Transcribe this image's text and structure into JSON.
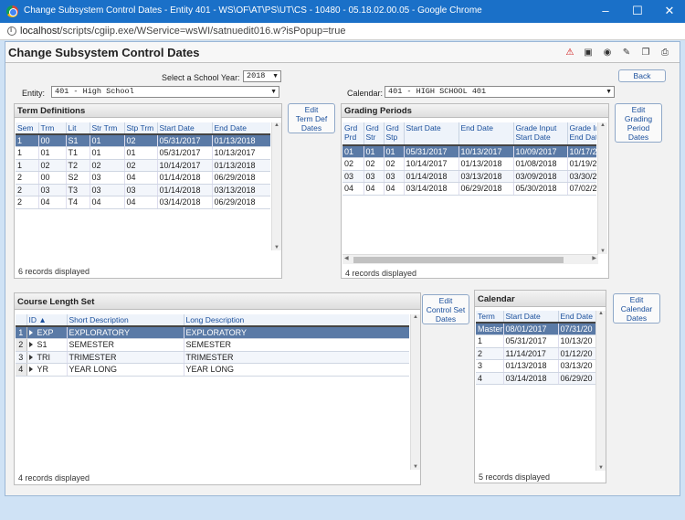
{
  "window": {
    "title": "Change Subsystem Control Dates - Entity 401 - WS\\OF\\AT\\PS\\UT\\CS - 10480 - 05.18.02.00.05 - Google Chrome",
    "url_host": "localhost",
    "url_path": "/scripts/cgiip.exe/WService=wsWI/satnuedit016.w?isPopup=true"
  },
  "page": {
    "title": "Change Subsystem Control Dates",
    "back_label": "Back",
    "school_year_label": "Select a School Year:",
    "school_year_value": "2018",
    "entity_label": "Entity:",
    "entity_value": "401 - High School",
    "calendar_label": "Calendar:",
    "calendar_value": "401 - HIGH SCHOOL 401"
  },
  "toolbar_icons": [
    "alert-icon",
    "screen-icon",
    "camera-icon",
    "notes-icon",
    "copy-icon",
    "print-icon"
  ],
  "term_definitions": {
    "title": "Term Definitions",
    "button_label": [
      "Edit",
      "Term Def",
      "Dates"
    ],
    "columns": [
      "Sem",
      "Trm",
      "Lit",
      "Str Trm",
      "Stp Trm",
      "Start Date",
      "End Date"
    ],
    "rows": [
      [
        "1",
        "00",
        "S1",
        "01",
        "02",
        "05/31/2017",
        "01/13/2018"
      ],
      [
        "1",
        "01",
        "T1",
        "01",
        "01",
        "05/31/2017",
        "10/13/2017"
      ],
      [
        "1",
        "02",
        "T2",
        "02",
        "02",
        "10/14/2017",
        "01/13/2018"
      ],
      [
        "2",
        "00",
        "S2",
        "03",
        "04",
        "01/14/2018",
        "06/29/2018"
      ],
      [
        "2",
        "03",
        "T3",
        "03",
        "03",
        "01/14/2018",
        "03/13/2018"
      ],
      [
        "2",
        "04",
        "T4",
        "04",
        "04",
        "03/14/2018",
        "06/29/2018"
      ]
    ],
    "footer": "6 records displayed"
  },
  "grading_periods": {
    "title": "Grading Periods",
    "button_label": [
      "Edit",
      "Grading",
      "Period",
      "Dates"
    ],
    "columns": [
      [
        "Grd",
        "Prd"
      ],
      [
        "Grd",
        "Str"
      ],
      [
        "Grd",
        "Stp"
      ],
      [
        "Start Date"
      ],
      [
        "End Date"
      ],
      [
        "Grade Input",
        "Start Date"
      ],
      [
        "Grade In",
        "End Date"
      ]
    ],
    "rows": [
      [
        "01",
        "01",
        "01",
        "05/31/2017",
        "10/13/2017",
        "10/09/2017",
        "10/17/2"
      ],
      [
        "02",
        "02",
        "02",
        "10/14/2017",
        "01/13/2018",
        "01/08/2018",
        "01/19/2"
      ],
      [
        "03",
        "03",
        "03",
        "01/14/2018",
        "03/13/2018",
        "03/09/2018",
        "03/30/2"
      ],
      [
        "04",
        "04",
        "04",
        "03/14/2018",
        "06/29/2018",
        "05/30/2018",
        "07/02/2"
      ]
    ],
    "footer": "4 records displayed"
  },
  "course_length_set": {
    "title": "Course Length Set",
    "button_label": [
      "Edit",
      "Control Set",
      "Dates"
    ],
    "columns": [
      "ID",
      "Short Description",
      "Long Description"
    ],
    "rows": [
      [
        "1",
        "EXP",
        "EXPLORATORY",
        "EXPLORATORY"
      ],
      [
        "2",
        "S1",
        "SEMESTER",
        "SEMESTER"
      ],
      [
        "3",
        "TRI",
        "TRIMESTER",
        "TRIMESTER"
      ],
      [
        "4",
        "YR",
        "YEAR LONG",
        "YEAR LONG"
      ]
    ],
    "footer": "4 records displayed"
  },
  "calendar": {
    "title": "Calendar",
    "button_label": [
      "Edit",
      "Calendar",
      "Dates"
    ],
    "columns": [
      "Term",
      "Start Date",
      "End Date"
    ],
    "rows": [
      [
        "Master",
        "08/01/2017",
        "07/31/20"
      ],
      [
        "1",
        "05/31/2017",
        "10/13/20"
      ],
      [
        "2",
        "11/14/2017",
        "01/12/20"
      ],
      [
        "3",
        "01/13/2018",
        "03/13/20"
      ],
      [
        "4",
        "03/14/2018",
        "06/29/20"
      ]
    ],
    "footer": "5 records displayed"
  }
}
